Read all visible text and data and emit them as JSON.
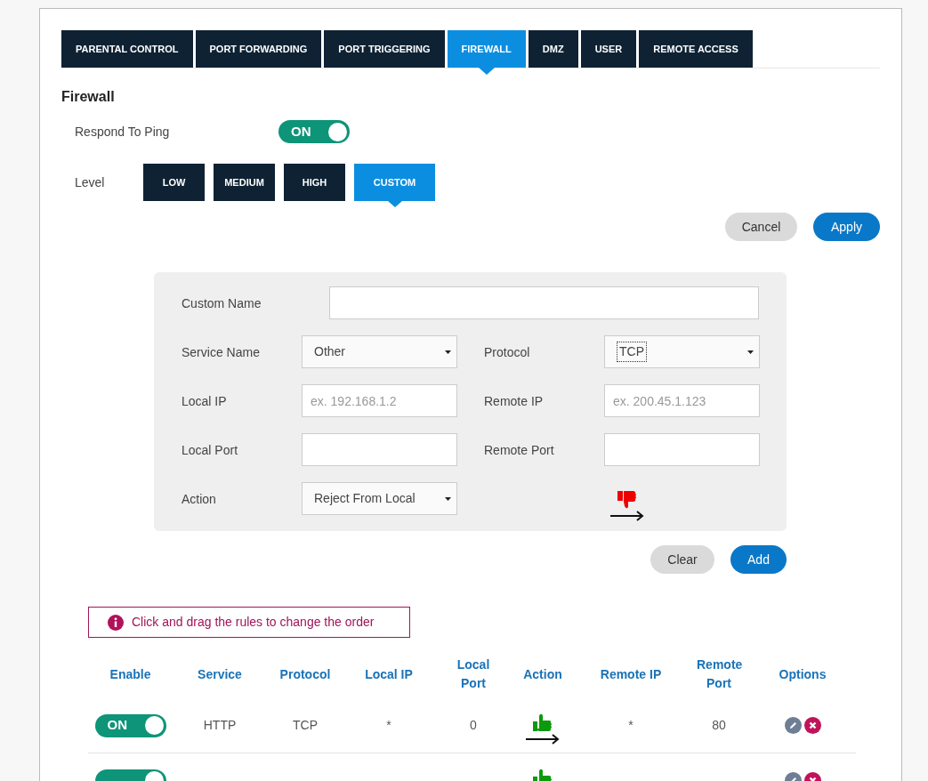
{
  "tabs": [
    {
      "label": "PARENTAL CONTROL",
      "selected": false
    },
    {
      "label": "PORT FORWARDING",
      "selected": false
    },
    {
      "label": "PORT TRIGGERING",
      "selected": false
    },
    {
      "label": "FIREWALL",
      "selected": true
    },
    {
      "label": "DMZ",
      "selected": false
    },
    {
      "label": "USER",
      "selected": false
    },
    {
      "label": "REMOTE ACCESS",
      "selected": false
    }
  ],
  "heading": "Firewall",
  "ping": {
    "label": "Respond To Ping",
    "on": true,
    "state_label": "ON"
  },
  "level": {
    "label": "Level",
    "options": [
      {
        "label": "LOW",
        "selected": false
      },
      {
        "label": "MEDIUM",
        "selected": false
      },
      {
        "label": "HIGH",
        "selected": false
      },
      {
        "label": "CUSTOM",
        "selected": true
      }
    ]
  },
  "top_buttons": {
    "cancel": "Cancel",
    "apply": "Apply"
  },
  "form": {
    "custom_name": {
      "label": "Custom Name"
    },
    "service_name": {
      "label": "Service Name",
      "value": "Other"
    },
    "protocol": {
      "label": "Protocol",
      "value": "TCP"
    },
    "local_ip": {
      "label": "Local IP",
      "placeholder": "ex. 192.168.1.2"
    },
    "remote_ip": {
      "label": "Remote IP",
      "placeholder": "ex. 200.45.1.123"
    },
    "local_port": {
      "label": "Local Port"
    },
    "remote_port": {
      "label": "Remote Port"
    },
    "action": {
      "label": "Action",
      "value": "Reject From Local",
      "kind": "reject"
    }
  },
  "form_buttons": {
    "clear": "Clear",
    "add": "Add"
  },
  "notice": "Click and drag the rules to change the order",
  "table": {
    "columns": [
      "Enable",
      "Service",
      "Protocol",
      "Local IP",
      "Local Port",
      "Action",
      "Remote IP",
      "Remote Port",
      "Options"
    ],
    "rows": [
      {
        "on": true,
        "state_label": "ON",
        "service": "HTTP",
        "protocol": "TCP",
        "local_ip": "*",
        "local_port": "0",
        "action": {
          "kind": "accept"
        },
        "remote_ip": "*",
        "remote_port": "80"
      },
      {
        "on": true,
        "action": {
          "kind": "accept"
        }
      }
    ]
  }
}
